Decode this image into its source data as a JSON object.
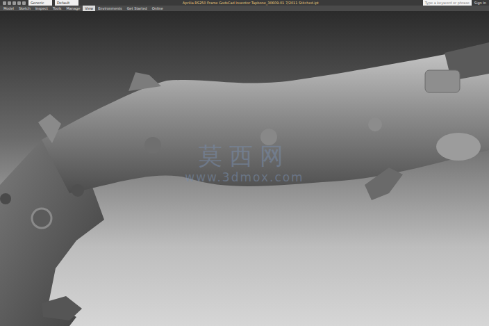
{
  "window": {
    "title": "Aprilia RS250 Frame GodsCad Inventor Tapbone_30609-01 7/2011 Stitched.ipt"
  },
  "quick_access": {
    "workspace": "Generic",
    "style": "Default"
  },
  "search": {
    "placeholder": "Type a keyword or phrase"
  },
  "sign_in": "Sign In",
  "tabs": [
    {
      "label": "Model",
      "selected": false
    },
    {
      "label": "Sketch",
      "selected": false
    },
    {
      "label": "Inspect",
      "selected": false
    },
    {
      "label": "Tools",
      "selected": false
    },
    {
      "label": "Manage",
      "selected": false
    },
    {
      "label": "View",
      "selected": true
    },
    {
      "label": "Environments",
      "selected": false
    },
    {
      "label": "Get Started",
      "selected": false
    },
    {
      "label": "Online",
      "selected": false
    }
  ],
  "watermark": {
    "title": "莫西网",
    "url": "www.3dmox.com"
  }
}
